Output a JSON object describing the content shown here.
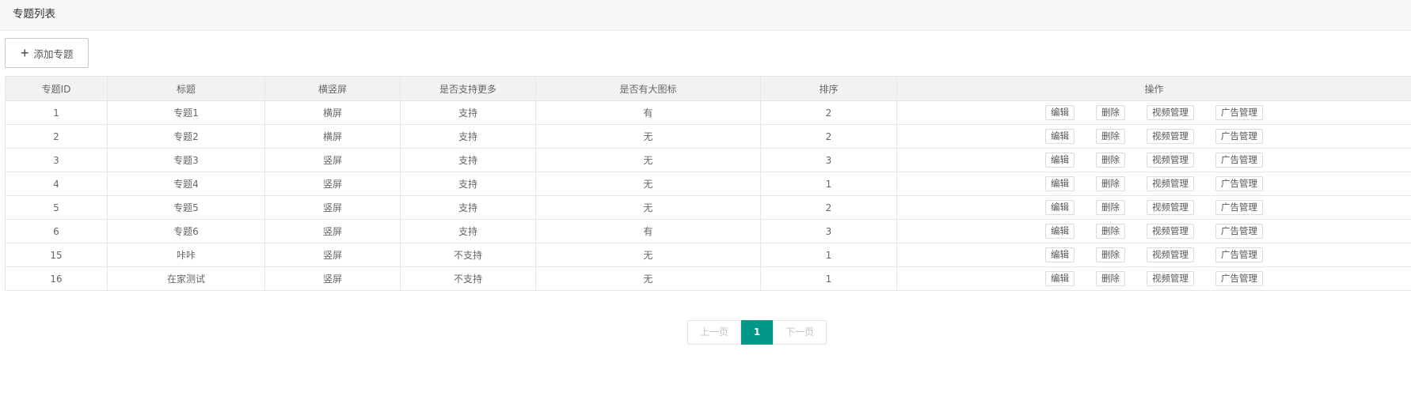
{
  "header": {
    "title": "专题列表"
  },
  "toolbar": {
    "add_label": "添加专题"
  },
  "table": {
    "columns": [
      "专题ID",
      "标题",
      "横竖屏",
      "是否支持更多",
      "是否有大图标",
      "排序",
      "操作"
    ],
    "rows": [
      {
        "id": "1",
        "title": "专题1",
        "orientation": "横屏",
        "support_more": "支持",
        "big_icon": "有",
        "sort": "2"
      },
      {
        "id": "2",
        "title": "专题2",
        "orientation": "横屏",
        "support_more": "支持",
        "big_icon": "无",
        "sort": "2"
      },
      {
        "id": "3",
        "title": "专题3",
        "orientation": "竖屏",
        "support_more": "支持",
        "big_icon": "无",
        "sort": "3"
      },
      {
        "id": "4",
        "title": "专题4",
        "orientation": "竖屏",
        "support_more": "支持",
        "big_icon": "无",
        "sort": "1"
      },
      {
        "id": "5",
        "title": "专题5",
        "orientation": "竖屏",
        "support_more": "支持",
        "big_icon": "无",
        "sort": "2"
      },
      {
        "id": "6",
        "title": "专题6",
        "orientation": "竖屏",
        "support_more": "支持",
        "big_icon": "有",
        "sort": "3"
      },
      {
        "id": "15",
        "title": "咔咔",
        "orientation": "竖屏",
        "support_more": "不支持",
        "big_icon": "无",
        "sort": "1"
      },
      {
        "id": "16",
        "title": "在家测试",
        "orientation": "竖屏",
        "support_more": "不支持",
        "big_icon": "无",
        "sort": "1"
      }
    ],
    "actions": [
      "编辑",
      "删除",
      "视频管理",
      "广告管理"
    ]
  },
  "pagination": {
    "prev": "上一页",
    "current": "1",
    "next": "下一页"
  },
  "colors": {
    "accent": "#009688"
  }
}
